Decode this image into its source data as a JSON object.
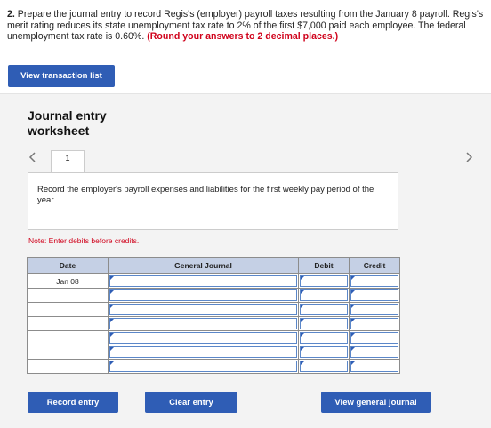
{
  "question": {
    "number": "2.",
    "text": "Prepare the journal entry to record Regis's (employer) payroll taxes resulting from the January 8 payroll. Regis's merit rating reduces its state unemployment tax rate to 2% of the first $7,000 paid each employee. The federal unemployment tax rate is 0.60%.",
    "hint": "(Round your answers to 2 decimal places.)"
  },
  "buttons": {
    "view_transaction_list": "View transaction list",
    "record_entry": "Record entry",
    "clear_entry": "Clear entry",
    "view_general_journal": "View general journal"
  },
  "worksheet": {
    "title": "Journal entry worksheet",
    "prev_icon": "chevron-left-icon",
    "next_icon": "chevron-right-icon",
    "current_tab": "1",
    "instruction": "Record the employer's payroll expenses and liabilities for the first weekly pay period of the year.",
    "note": "Note: Enter debits before credits."
  },
  "table": {
    "headers": [
      "Date",
      "General Journal",
      "Debit",
      "Credit"
    ],
    "rows": [
      {
        "date": "Jan 08"
      },
      {
        "date": ""
      },
      {
        "date": ""
      },
      {
        "date": ""
      },
      {
        "date": ""
      },
      {
        "date": ""
      },
      {
        "date": ""
      }
    ]
  }
}
